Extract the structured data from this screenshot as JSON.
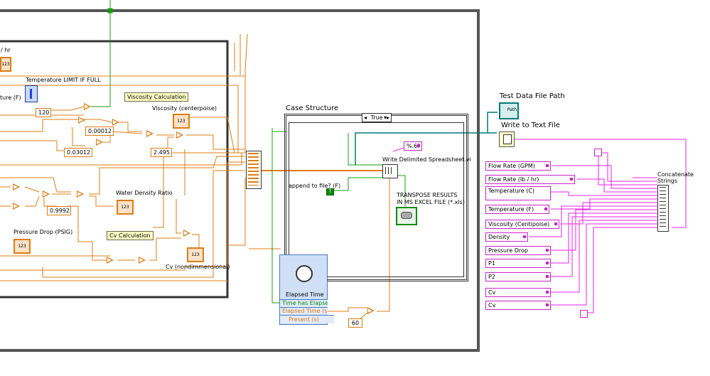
{
  "outer_loop": {},
  "inner_loop": {
    "indicator_partial_top": "/ hr",
    "temp_limit_label": "Temperature LIMIT IF FULL",
    "temp_partial_label": "ture (F)",
    "const_120": "120",
    "viscosity_calc_caption": "Viscosity Calculation",
    "viscosity_label": "Viscosity (centerpoise)",
    "const_000012": "0.00012",
    "const_003012": "0.03012",
    "const_2495": "2.495",
    "const_09992": "0.9992",
    "water_density_label": "Water Density Ratio",
    "pressure_drop_label": "Pressure Drop (PSIG)",
    "cv_calc_caption": "Cv Calculation",
    "cv_label": "Cv (nondimmensional)",
    "numeric_indicator_text": "123"
  },
  "case_structure": {
    "label": "Case Structure",
    "selector_value": "True",
    "format_const": "%.6f",
    "write_spreadsheet_label": "Write Delimited Spreadsheet.vi",
    "append_label": "append to file? (F)",
    "bool_const": "T",
    "transpose_label_1": "TRANSPOSE RESULTS",
    "transpose_label_2": "IN MS EXCEL FILE (*.xls)"
  },
  "elapsed_time": {
    "title": "Elapsed Time",
    "outputs": [
      "Time has Elapsed",
      "Elapsed Time (s)",
      "Present (s)"
    ],
    "const_60": "60"
  },
  "file_io": {
    "path_label": "Test Data File Path",
    "path_icon_text": "Path",
    "write_text_label": "Write to Text File"
  },
  "string_constants": [
    "Flow Rate (GPM)",
    "Flow Rate (lb / hr)",
    "Temperature (C)",
    "Temperature (F)",
    "Viscosity (Centipoise)",
    "Density",
    "Pressure Drop",
    "P1",
    "P2",
    "Cv",
    "Cv"
  ],
  "concatenate": {
    "label_line1": "Concatenate",
    "label_line2": "Strings"
  },
  "colors": {
    "orange_wire": "#e07c10",
    "pink_wire": "#ee22ee",
    "teal_wire": "#007a7a",
    "green_wire": "#10a010",
    "frame": "#4a4a4a"
  }
}
